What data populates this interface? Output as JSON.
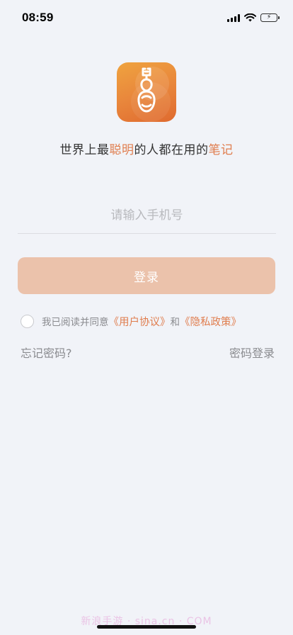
{
  "status_bar": {
    "time": "08:59",
    "battery_color": "#4cd964"
  },
  "logo": {
    "icon": "violin-note-logo-icon"
  },
  "slogan": {
    "part1": "世界上最",
    "highlight1": "聪明",
    "part2": "的人都在用的",
    "highlight2": "笔记"
  },
  "phone_input": {
    "placeholder": "请输入手机号",
    "value": ""
  },
  "login_button": {
    "label": "登录"
  },
  "agreement": {
    "prefix": "我已阅读并同意",
    "user_agreement": "《用户协议》",
    "connector": "和",
    "privacy_policy": "《隐私政策》"
  },
  "links": {
    "forgot_password": "忘记密码?",
    "password_login": "密码登录"
  },
  "watermark": "新浪手游 · sina.cn · COM",
  "colors": {
    "accent": "#e07d4e",
    "button": "#ebc2ab",
    "background": "#f1f3f8"
  }
}
